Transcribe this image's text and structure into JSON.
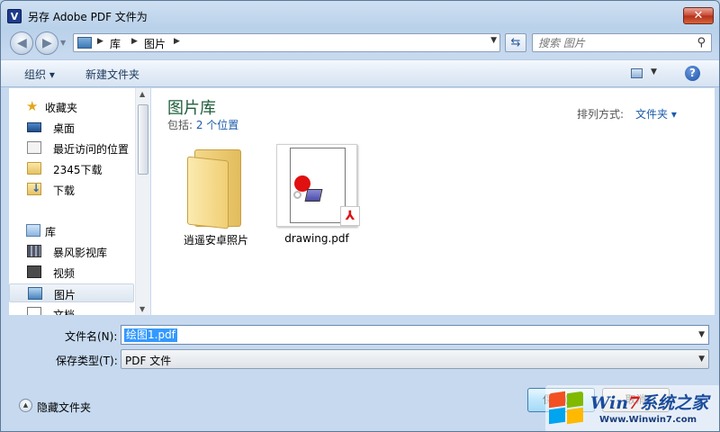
{
  "window": {
    "app_icon_letter": "V",
    "title": "另存 Adobe PDF 文件为",
    "close_symbol": "✕"
  },
  "address": {
    "breadcrumbs": [
      "库",
      "图片"
    ],
    "search_placeholder": "搜索 图片"
  },
  "toolbar": {
    "organize_label": "组织 ▾",
    "new_folder_label": "新建文件夹",
    "help_symbol": "?"
  },
  "nav": {
    "items": [
      {
        "label": "收藏夹",
        "icon": "star-icon",
        "type": "header"
      },
      {
        "label": "桌面",
        "icon": "desktop-icon",
        "type": "item"
      },
      {
        "label": "最近访问的位置",
        "icon": "recent-places-icon",
        "type": "item"
      },
      {
        "label": "2345下载",
        "icon": "folder-icon",
        "type": "item"
      },
      {
        "label": "下载",
        "icon": "downloads-icon",
        "type": "item"
      },
      {
        "label": "库",
        "icon": "library-icon",
        "type": "header"
      },
      {
        "label": "暴风影视库",
        "icon": "video-library-icon",
        "type": "item"
      },
      {
        "label": "视频",
        "icon": "film-icon",
        "type": "item"
      },
      {
        "label": "图片",
        "icon": "pictures-icon",
        "type": "item",
        "selected": true
      },
      {
        "label": "文档",
        "icon": "document-icon",
        "type": "item"
      }
    ]
  },
  "content": {
    "title": "图片库",
    "includes_prefix": "包括: ",
    "includes_link": "2 个位置",
    "arrange_label": "排列方式:",
    "arrange_value": "文件夹 ▾",
    "files": [
      {
        "name": "逍遥安卓照片",
        "icon": "folder-icon"
      },
      {
        "name": "drawing.pdf",
        "icon": "pdf-icon"
      }
    ]
  },
  "form": {
    "filename_label": "文件名(N):",
    "filename_value": "绘图1.pdf",
    "filetype_label": "保存类型(T):",
    "filetype_value": "PDF 文件",
    "hide_folders_label": "隐藏文件夹",
    "save_label": "保存(S)",
    "cancel_label": "取消"
  },
  "watermark": {
    "brand_prefix": "Win",
    "brand_seven": "7",
    "brand_suffix": "系统之家",
    "url": "Www.Winwin7.com"
  }
}
